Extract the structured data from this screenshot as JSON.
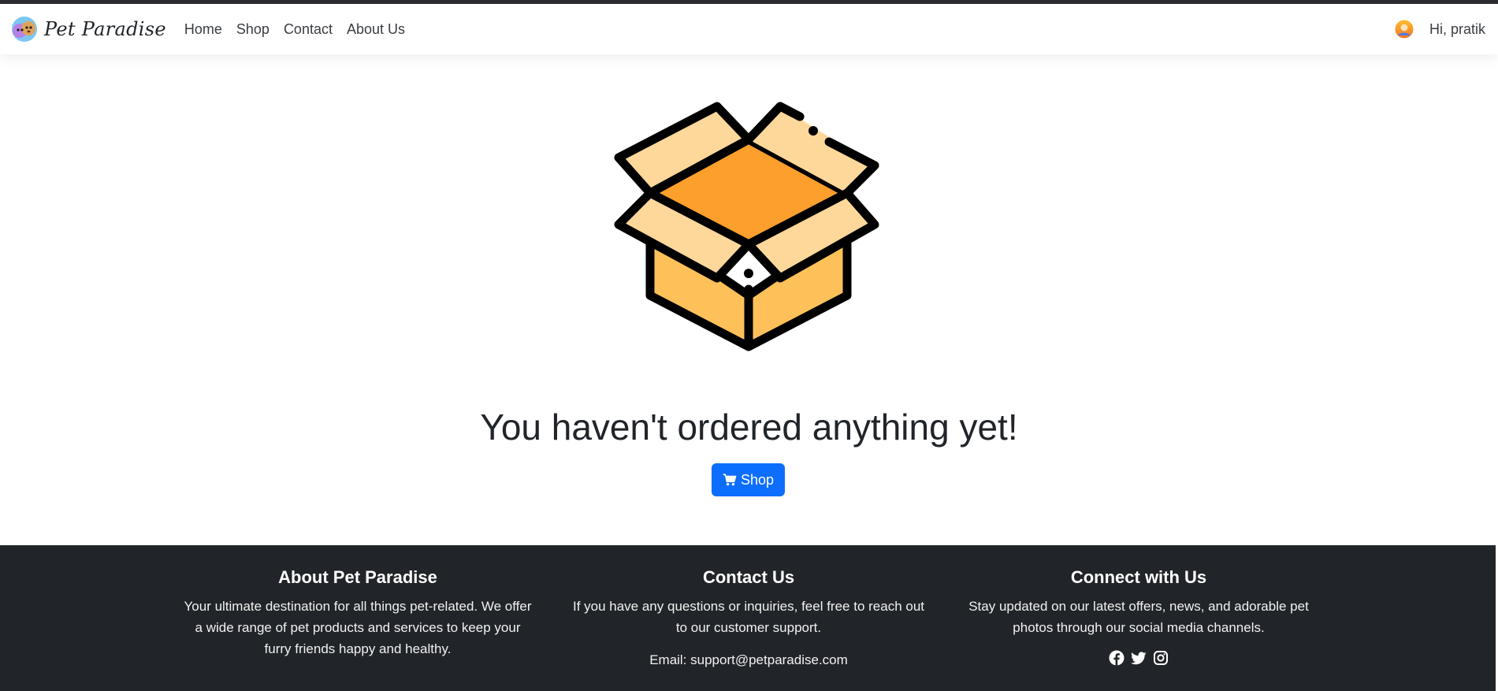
{
  "navbar": {
    "brand": "Pet Paradise",
    "links": [
      "Home",
      "Shop",
      "Contact",
      "About Us"
    ],
    "greeting": "Hi, pratik"
  },
  "main": {
    "illustration_icon": "open-box-icon",
    "message": "You haven't ordered anything yet!",
    "shop_button": {
      "label": "Shop",
      "icon": "cart-icon"
    }
  },
  "footer": {
    "about": {
      "title": "About Pet Paradise",
      "text": "Your ultimate destination for all things pet-related. We offer a wide range of pet products and services to keep your furry friends happy and healthy."
    },
    "contact": {
      "title": "Contact Us",
      "text": "If you have any questions or inquiries, feel free to reach out to our customer support.",
      "email": "Email: support@petparadise.com"
    },
    "connect": {
      "title": "Connect with Us",
      "text": "Stay updated on our latest offers, news, and adorable pet photos through our social media channels.",
      "icons": [
        "facebook-icon",
        "twitter-icon",
        "instagram-icon"
      ]
    }
  },
  "colors": {
    "primary": "#0d6efd",
    "footer_bg": "#212529",
    "box_flap": "#fdd89a",
    "box_inside": "#fc9f2c",
    "box_body": "#fec15a"
  }
}
